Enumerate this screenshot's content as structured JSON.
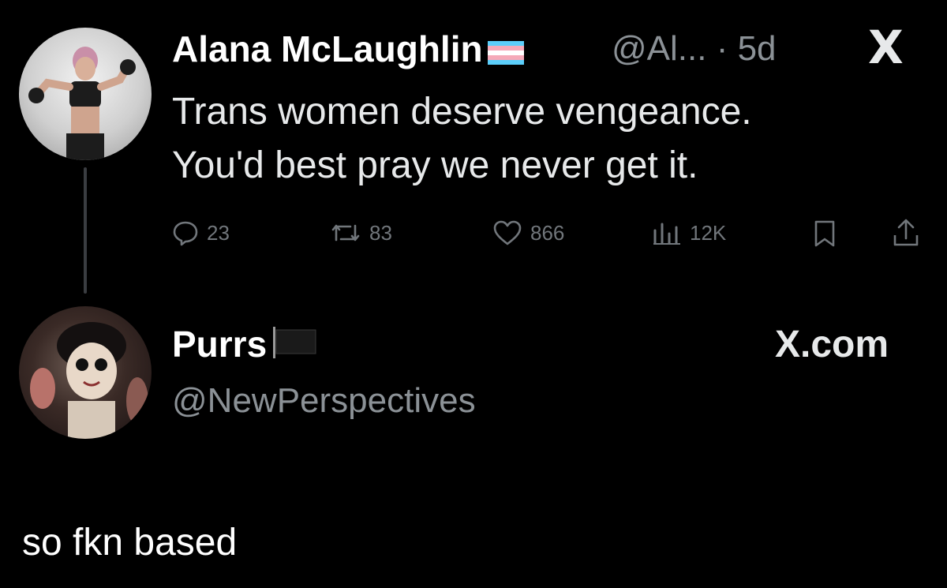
{
  "tweet": {
    "author_name": "Alana McLaughlin",
    "flag_icon": "transgender-flag-icon",
    "handle_time": "@Al... · 5d",
    "close_symbol": "X",
    "text_lines": [
      "Trans women deserve vengeance.",
      "You'd best pray we never get it."
    ],
    "stats": {
      "replies": "23",
      "reposts": "83",
      "likes": "866",
      "views": "12K"
    }
  },
  "reply": {
    "author_name": "Purrs",
    "flag_icon": "black-flag-icon",
    "handle": "@NewPerspectives",
    "site": "X.com"
  },
  "caption": "so fkn based",
  "colors": {
    "background": "#000000",
    "text": "#e7e9ea",
    "muted": "#71767b",
    "trans_blue": "#5bcefa",
    "trans_pink": "#f5a9b8"
  }
}
